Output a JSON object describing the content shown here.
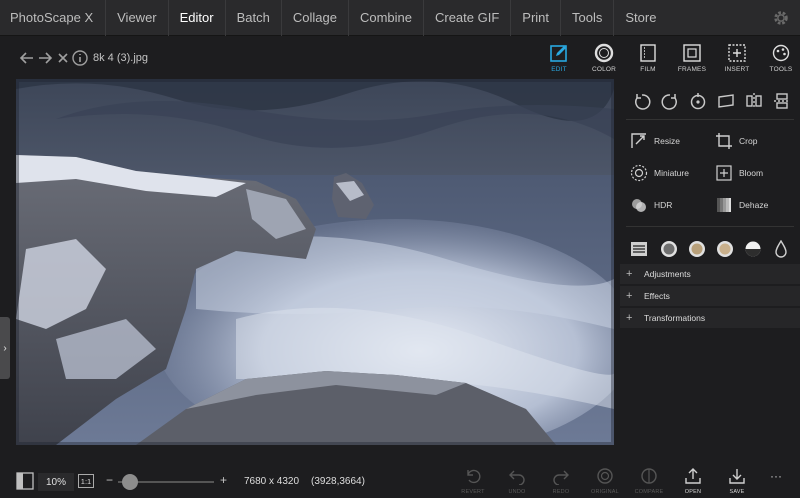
{
  "menu": {
    "items": [
      "PhotoScape X",
      "Viewer",
      "Editor",
      "Batch",
      "Collage",
      "Combine",
      "Create GIF",
      "Print",
      "Tools",
      "Store"
    ],
    "active": "Editor"
  },
  "toolbar": {
    "filename": "8k 4 (3).jpg",
    "tabs": [
      "EDIT",
      "COLOR",
      "FILM",
      "FRAMES",
      "INSERT",
      "TOOLS"
    ],
    "active_tab": "EDIT"
  },
  "panel": {
    "tools": {
      "resize": "Resize",
      "crop": "Crop",
      "miniature": "Miniature",
      "bloom": "Bloom",
      "hdr": "HDR",
      "dehaze": "Dehaze"
    },
    "sections": [
      "Adjustments",
      "Effects",
      "Transformations"
    ]
  },
  "bottom": {
    "zoom": "10%",
    "ratio": "1:1",
    "minus": "−",
    "plus": "+",
    "dimensions": "7680 x 4320",
    "coords": "(3928,3664)",
    "actions": [
      "REVERT",
      "UNDO",
      "REDO",
      "ORIGINAL",
      "COMPARE",
      "OPEN",
      "SAVE"
    ],
    "more": "···"
  },
  "colors": {
    "accent": "#29a8e0",
    "menubar": "#2a2a2c",
    "background": "#1d1d1f"
  }
}
